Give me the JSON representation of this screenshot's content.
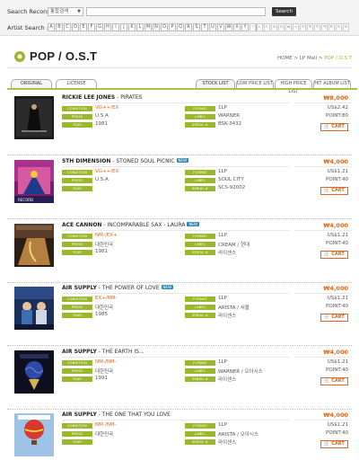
{
  "search": {
    "record_label": "Search Record :",
    "select_value": "통합검색",
    "button": "Search",
    "artist_label": "Artist Search :",
    "letters": [
      "A",
      "B",
      "C",
      "D",
      "E",
      "F",
      "G",
      "H",
      "I",
      "J",
      "K",
      "L",
      "M",
      "N",
      "O",
      "P",
      "Q",
      "R",
      "S",
      "T",
      "U",
      "V",
      "W",
      "X",
      "Y",
      "Z",
      "etc"
    ],
    "hangul": [
      "ㄱ",
      "ㄴ",
      "ㄷ",
      "ㄹ",
      "ㅁ",
      "ㅂ",
      "ㅅ",
      "ㅇ",
      "ㅈ",
      "ㅊ",
      "ㅋ",
      "ㅌ",
      "ㅍ",
      "ㅎ"
    ]
  },
  "page": {
    "title": "POP / O.S.T",
    "breadcrumb": {
      "home": "HOME",
      "sep1": " > ",
      "mid": "LP Mall",
      "sep2": " > ",
      "current": "POP / O.S.T"
    }
  },
  "tabs": {
    "left": [
      "ORIGINAL",
      "LICENSE"
    ],
    "right": [
      "STOCK LIST",
      "LOW PRICE LIST",
      "HIGH PRICE LIST",
      "HIT ALBUM LIST"
    ]
  },
  "labels": {
    "condition": "CONDITION",
    "pressing": "PRESS",
    "year": "YEAR",
    "format": "FORMAT",
    "label": "LABEL",
    "serial": "SERIAL #",
    "cart": "CART",
    "new": "NEW"
  },
  "colors": {
    "accent_green": "#9ab82b",
    "accent_orange": "#e0671c",
    "badge_blue": "#2a8bb5"
  },
  "products": [
    {
      "artist": "RICKIE LEE JONES",
      "sep": " - ",
      "album": "PIRATES",
      "is_new": false,
      "price": "₩8,000",
      "condition": "VG++/EX",
      "press": "U.S.A",
      "year": "1981",
      "format": "1LP",
      "label": "WARNER",
      "serial": "BSK-3432",
      "usd": "US$2.42",
      "point": "POINT:80",
      "cover": "pirates"
    },
    {
      "artist": "5TH DIMENSION",
      "sep": " - ",
      "album": "STONED SOUL PICNIC",
      "is_new": true,
      "price": "₩4,000",
      "condition": "VG++/EX",
      "press": "U.S.A",
      "year": "",
      "format": "1LP",
      "label": "SOUL CITY",
      "serial": "SCS-92002",
      "usd": "US$1.21",
      "point": "POINT:40",
      "cover": "picnic"
    },
    {
      "artist": "ACE CANNON",
      "sep": " - ",
      "album": "INCOMPARABLE SAX - LAURA",
      "is_new": true,
      "price": "₩4,000",
      "condition": "NM-/EX+",
      "press": "대한민국",
      "year": "1981",
      "format": "1LP",
      "label": "CREAM / 현대",
      "serial": "라이센스",
      "usd": "US$1.21",
      "point": "POINT:40",
      "cover": "sax"
    },
    {
      "artist": "AIR SUPPLY",
      "sep": " - ",
      "album": "THE POWER OF LOVE",
      "is_new": true,
      "price": "₩4,000",
      "condition": "EX+/NM-",
      "press": "대한민국",
      "year": "1985",
      "format": "1LP",
      "label": "ARISTA / 서울",
      "serial": "라이센스",
      "usd": "US$1.21",
      "point": "POINT:40",
      "cover": "power"
    },
    {
      "artist": "AIR SUPPLY",
      "sep": " - ",
      "album": "THE EARTH IS...",
      "is_new": false,
      "price": "₩4,000",
      "condition": "NM-/NM-",
      "press": "대한민국",
      "year": "1991",
      "format": "1LP",
      "label": "WARNER / 오아시스",
      "serial": "라이센스",
      "usd": "US$1.21",
      "point": "POINT:40",
      "cover": "earth"
    },
    {
      "artist": "AIR SUPPLY",
      "sep": " - ",
      "album": "THE ONE THAT YOU LOVE",
      "is_new": false,
      "price": "₩4,000",
      "condition": "NM-/NM-",
      "press": "대한민국",
      "year": "",
      "format": "1LP",
      "label": "ARISTA / 오아시스",
      "serial": "라이센스",
      "usd": "US$1.21",
      "point": "POINT:40",
      "cover": "balloon"
    }
  ]
}
